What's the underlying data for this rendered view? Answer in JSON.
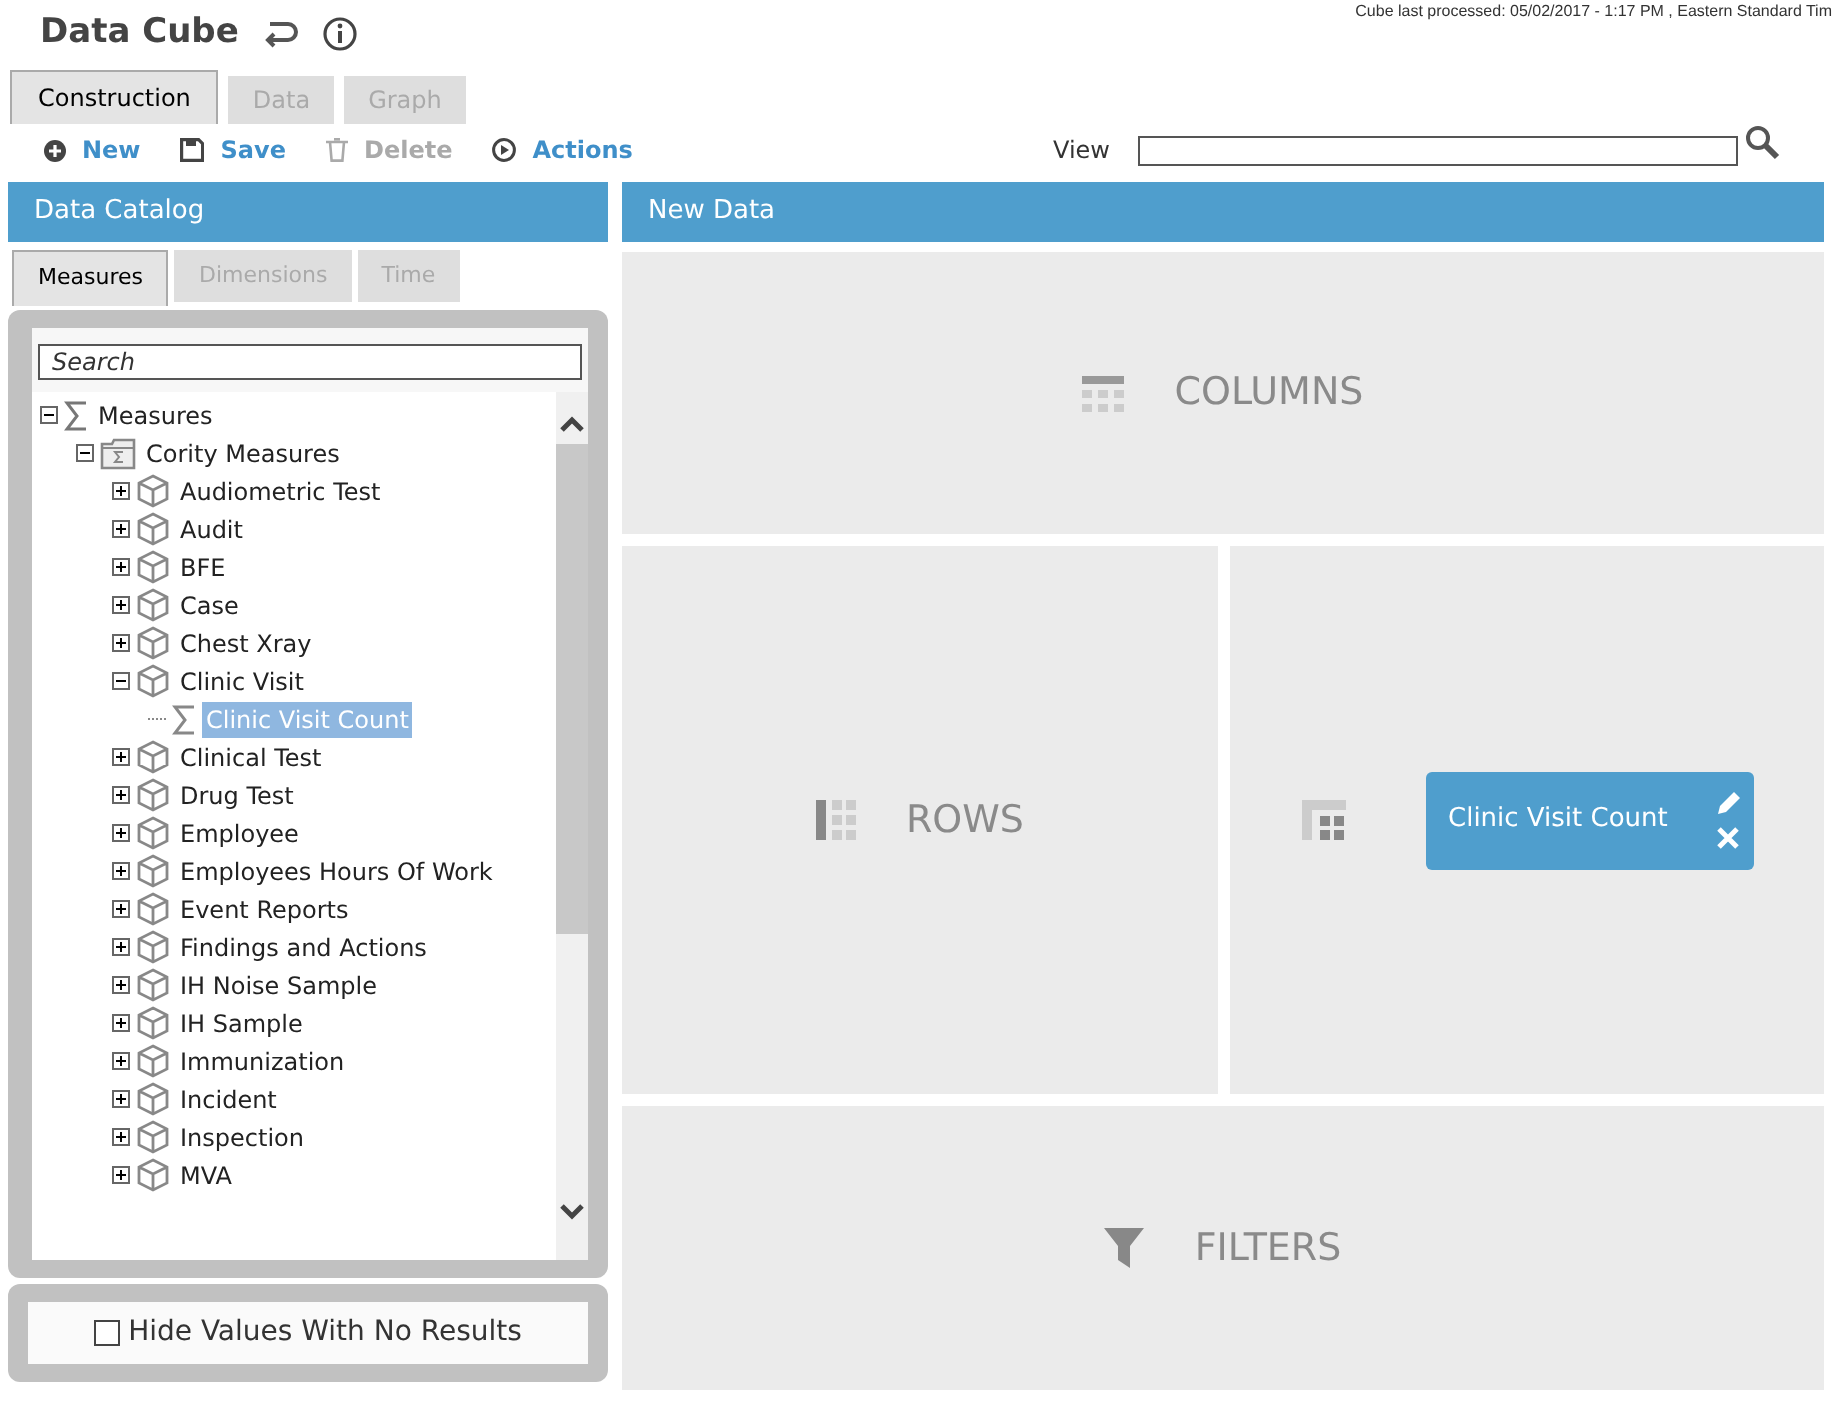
{
  "header": {
    "title": "Data Cube",
    "processed": "Cube last processed:  05/02/2017 - 1:17 PM , Eastern Standard Tim"
  },
  "tabs": [
    {
      "label": "Construction",
      "selected": true
    },
    {
      "label": "Data",
      "selected": false
    },
    {
      "label": "Graph",
      "selected": false
    }
  ],
  "toolbar": [
    {
      "kind": "new",
      "label": "New",
      "disabled": false
    },
    {
      "kind": "save",
      "label": "Save",
      "disabled": false
    },
    {
      "kind": "delete",
      "label": "Delete",
      "disabled": true
    },
    {
      "kind": "actions",
      "label": "Actions",
      "disabled": false
    }
  ],
  "view": {
    "label": "View"
  },
  "catalog": {
    "title": "Data Catalog",
    "tabs": [
      {
        "label": "Measures",
        "selected": true
      },
      {
        "label": "Dimensions",
        "selected": false
      },
      {
        "label": "Time",
        "selected": false
      }
    ],
    "search": {
      "placeholder": "Search"
    },
    "tree": [
      {
        "kind": "sigma",
        "label": "Measures",
        "expanded": true,
        "selected": false,
        "children": [
          {
            "kind": "folder",
            "label": "Cority Measures",
            "expanded": true,
            "selected": false,
            "children": [
              {
                "kind": "cube",
                "label": "Audiometric Test",
                "expanded": false,
                "selected": false
              },
              {
                "kind": "cube",
                "label": "Audit",
                "expanded": false,
                "selected": false
              },
              {
                "kind": "cube",
                "label": "BFE",
                "expanded": false,
                "selected": false
              },
              {
                "kind": "cube",
                "label": "Case",
                "expanded": false,
                "selected": false
              },
              {
                "kind": "cube",
                "label": "Chest Xray",
                "expanded": false,
                "selected": false
              },
              {
                "kind": "cube",
                "label": "Clinic Visit",
                "expanded": true,
                "selected": false,
                "children": [
                  {
                    "kind": "measure",
                    "label": "Clinic Visit Count",
                    "selected": true
                  }
                ]
              },
              {
                "kind": "cube",
                "label": "Clinical Test",
                "expanded": false,
                "selected": false
              },
              {
                "kind": "cube",
                "label": "Drug Test",
                "expanded": false,
                "selected": false
              },
              {
                "kind": "cube",
                "label": "Employee",
                "expanded": false,
                "selected": false
              },
              {
                "kind": "cube",
                "label": "Employees Hours Of Work",
                "expanded": false,
                "selected": false
              },
              {
                "kind": "cube",
                "label": "Event Reports",
                "expanded": false,
                "selected": false
              },
              {
                "kind": "cube",
                "label": "Findings and Actions",
                "expanded": false,
                "selected": false
              },
              {
                "kind": "cube",
                "label": "IH Noise Sample",
                "expanded": false,
                "selected": false
              },
              {
                "kind": "cube",
                "label": "IH Sample",
                "expanded": false,
                "selected": false
              },
              {
                "kind": "cube",
                "label": "Immunization",
                "expanded": false,
                "selected": false
              },
              {
                "kind": "cube",
                "label": "Incident",
                "expanded": false,
                "selected": false
              },
              {
                "kind": "cube",
                "label": "Inspection",
                "expanded": false,
                "selected": false
              },
              {
                "kind": "cube",
                "label": "MVA",
                "expanded": false,
                "selected": false
              }
            ]
          }
        ]
      }
    ],
    "hide_empty": {
      "label": "Hide Values With No Results",
      "checked": false
    }
  },
  "new_data": {
    "title": "New Data",
    "columns": {
      "label": "COLUMNS"
    },
    "rows": {
      "label": "ROWS"
    },
    "measures": [
      {
        "label": "Clinic Visit Count"
      }
    ],
    "filters": {
      "label": "FILTERS"
    }
  }
}
